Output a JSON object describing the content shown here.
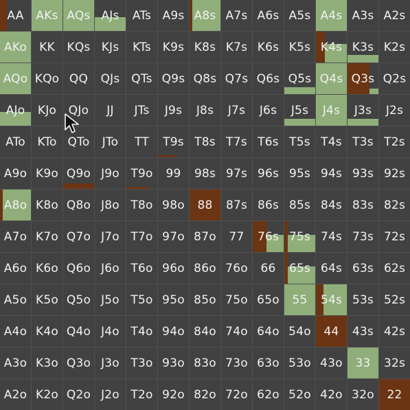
{
  "colors": {
    "fold": "#414141",
    "call": "#8fae7a",
    "raise": "#6b3413"
  },
  "range_grid": {
    "rows": [
      [
        "AA",
        "AKs",
        "AQs",
        "AJs",
        "ATs",
        "A9s",
        "A8s",
        "A7s",
        "A6s",
        "A5s",
        "A4s",
        "A3s",
        "A2s"
      ],
      [
        "AKo",
        "KK",
        "KQs",
        "KJs",
        "KTs",
        "K9s",
        "K8s",
        "K7s",
        "K6s",
        "K5s",
        "K4s",
        "K3s",
        "K2s"
      ],
      [
        "AQo",
        "KQo",
        "QQ",
        "QJs",
        "QTs",
        "Q9s",
        "Q8s",
        "Q7s",
        "Q6s",
        "Q5s",
        "Q4s",
        "Q3s",
        "Q2s"
      ],
      [
        "AJo",
        "KJo",
        "QJo",
        "JJ",
        "JTs",
        "J9s",
        "J8s",
        "J7s",
        "J6s",
        "J5s",
        "J4s",
        "J3s",
        "J2s"
      ],
      [
        "ATo",
        "KTo",
        "QTo",
        "JTo",
        "TT",
        "T9s",
        "T8s",
        "T7s",
        "T6s",
        "T5s",
        "T4s",
        "T3s",
        "T2s"
      ],
      [
        "A9o",
        "K9o",
        "Q9o",
        "J9o",
        "T9o",
        "99",
        "98s",
        "97s",
        "96s",
        "95s",
        "94s",
        "93s",
        "92s"
      ],
      [
        "A8o",
        "K8o",
        "Q8o",
        "J8o",
        "T8o",
        "98o",
        "88",
        "87s",
        "86s",
        "85s",
        "84s",
        "83s",
        "82s"
      ],
      [
        "A7o",
        "K7o",
        "Q7o",
        "J7o",
        "T7o",
        "97o",
        "87o",
        "77",
        "76s",
        "75s",
        "74s",
        "73s",
        "72s"
      ],
      [
        "A6o",
        "K6o",
        "Q6o",
        "J6o",
        "T6o",
        "96o",
        "86o",
        "76o",
        "66",
        "65s",
        "64s",
        "63s",
        "62s"
      ],
      [
        "A5o",
        "K5o",
        "Q5o",
        "J5o",
        "T5o",
        "95o",
        "85o",
        "75o",
        "65o",
        "55",
        "54s",
        "53s",
        "52s"
      ],
      [
        "A4o",
        "K4o",
        "Q4o",
        "J4o",
        "T4o",
        "94o",
        "84o",
        "74o",
        "64o",
        "54o",
        "44",
        "43s",
        "42s"
      ],
      [
        "A3o",
        "K3o",
        "Q3o",
        "J3o",
        "T3o",
        "93o",
        "83o",
        "73o",
        "63o",
        "53o",
        "43o",
        "33",
        "32s"
      ],
      [
        "A2o",
        "K2o",
        "Q2o",
        "J2o",
        "T2o",
        "92o",
        "82o",
        "72o",
        "62o",
        "52o",
        "42o",
        "32o",
        "22"
      ]
    ],
    "mix": {
      "AA": {
        "raise": 0.22,
        "call": 0.0,
        "call_height": 1.0
      },
      "AKs": {
        "raise": 0.0,
        "call": 1.0
      },
      "AQs": {
        "raise": 0.0,
        "call": 1.0
      },
      "AJs": {
        "raise": 0.0,
        "call": 1.0,
        "call_height": 0.45
      },
      "A8s": {
        "raise": 0.08,
        "call": 0.92
      },
      "A4s": {
        "raise": 0.0,
        "call": 1.0
      },
      "AKo": {
        "raise": 0.0,
        "call": 1.0
      },
      "K4s": {
        "raise": 0.28,
        "call": 0.72,
        "call_height": 0.6
      },
      "K3s": {
        "raise": 0.0,
        "call": 1.0,
        "call_height": 0.25
      },
      "AQo": {
        "raise": 0.0,
        "call": 1.0
      },
      "Q5s": {
        "raise": 0.0,
        "call": 1.0,
        "call_height": 0.22
      },
      "Q4s": {
        "raise": 0.0,
        "call": 1.0
      },
      "Q3s": {
        "raise": 0.7,
        "call": 0.3,
        "call_height": 0.18
      },
      "AJo": {
        "raise": 0.0,
        "call": 1.0,
        "call_height": 0.45
      },
      "J5s": {
        "raise": 0.0,
        "call": 1.0,
        "call_height": 0.22
      },
      "J4s": {
        "raise": 0.0,
        "call": 1.0
      },
      "J3s": {
        "raise": 0.0,
        "call": 1.0,
        "call_height": 0.22
      },
      "T9s": {
        "raise": 0.55,
        "call": 0.0,
        "raise_height": 0.06
      },
      "Q9o": {
        "raise": 1.0,
        "call": 0.0,
        "raise_height": 0.18
      },
      "T9o": {
        "raise": 0.75,
        "call": 0.0,
        "raise_height": 0.06
      },
      "A8o": {
        "raise": 0.08,
        "call": 0.92
      },
      "88": {
        "raise": 1.0,
        "call": 0.0
      },
      "76s": {
        "raise": 0.45,
        "call": 0.55,
        "call_height": 0.55
      },
      "75s": {
        "raise": 0.12,
        "call": 0.88,
        "call_height": 0.55
      },
      "65s": {
        "raise": 0.1,
        "call": 0.9,
        "call_height": 0.55
      },
      "55": {
        "raise": 0.0,
        "call": 1.0
      },
      "54s": {
        "raise": 0.25,
        "call": 0.75
      },
      "44": {
        "raise": 1.0,
        "call": 0.0
      },
      "33": {
        "raise": 0.0,
        "call": 1.0
      },
      "22": {
        "raise": 1.0,
        "call": 0.0
      }
    }
  },
  "cursor": {
    "icon": "mouse-pointer-icon"
  }
}
